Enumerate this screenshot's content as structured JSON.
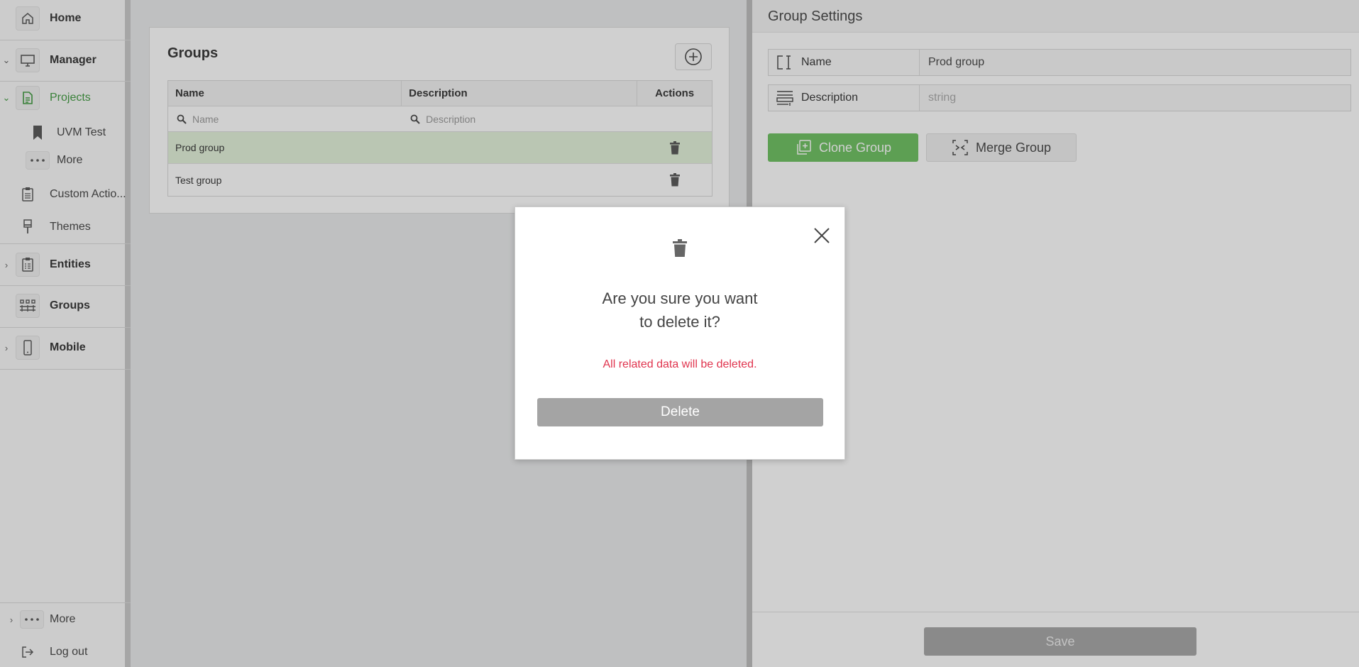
{
  "sidebar": {
    "items": [
      {
        "label": "Home",
        "icon": "home-icon"
      },
      {
        "label": "Manager",
        "icon": "monitor-icon"
      },
      {
        "label": "Projects",
        "icon": "document-icon"
      },
      {
        "label": "UVM Test",
        "icon": "bookmark-icon"
      },
      {
        "label": "More",
        "icon": "more-icon"
      },
      {
        "label": "Custom Actio...",
        "icon": "clipboard-icon"
      },
      {
        "label": "Themes",
        "icon": "brush-icon"
      },
      {
        "label": "Entities",
        "icon": "clipboard-list-icon"
      },
      {
        "label": "Groups",
        "icon": "groups-icon"
      },
      {
        "label": "Mobile",
        "icon": "mobile-icon"
      }
    ],
    "bottom": [
      {
        "label": "More",
        "icon": "more-icon"
      },
      {
        "label": "Log out",
        "icon": "logout-icon"
      }
    ],
    "active_color": "#3e9a3e"
  },
  "groups": {
    "title": "Groups",
    "columns": {
      "name": "Name",
      "description": "Description",
      "actions": "Actions"
    },
    "filters": {
      "name_placeholder": "Name",
      "description_placeholder": "Description"
    },
    "rows": [
      {
        "name": "Prod group",
        "description": ""
      },
      {
        "name": "Test group",
        "description": ""
      }
    ]
  },
  "settings": {
    "title": "Group Settings",
    "name_label": "Name",
    "name_value": "Prod group",
    "description_label": "Description",
    "description_placeholder": "string",
    "clone_label": "Clone Group",
    "merge_label": "Merge Group",
    "save_label": "Save",
    "accent_color": "#6cc05f"
  },
  "modal": {
    "question_line1": "Are you sure you want",
    "question_line2": "to delete it?",
    "warning": "All related data will be deleted.",
    "delete_label": "Delete",
    "warning_color": "#e0344e"
  }
}
